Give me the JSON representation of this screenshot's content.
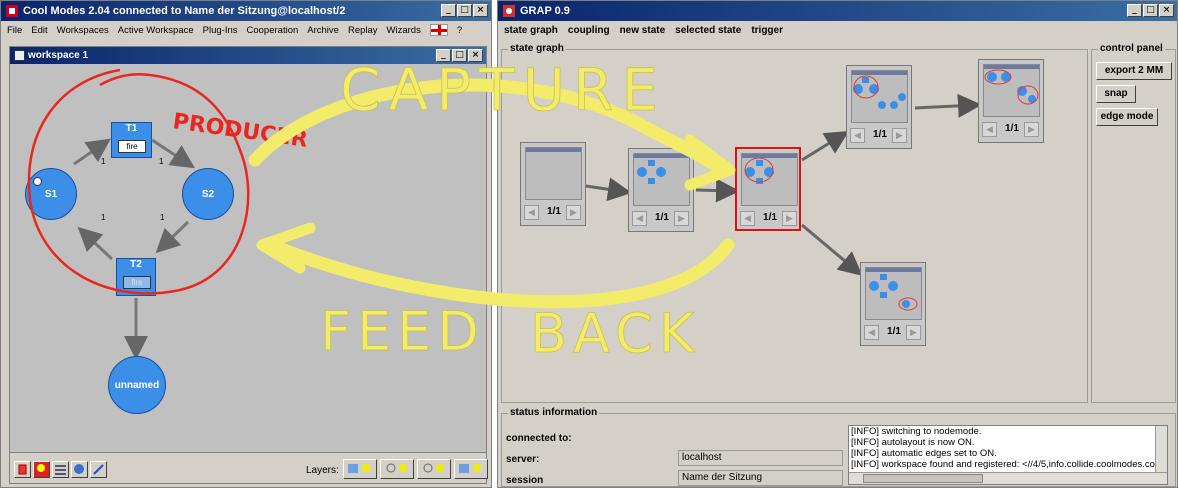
{
  "coolmodes": {
    "title": "Cool Modes 2.04 connected to Name der Sitzung@localhost/2",
    "menu": [
      "File",
      "Edit",
      "Workspaces",
      "Active Workspace",
      "Plug-Ins",
      "Cooperation",
      "Archive",
      "Replay",
      "Wizards",
      "?"
    ],
    "workspace_title": "workspace 1",
    "places": {
      "s1": "S1",
      "s2": "S2",
      "unnamed": "unnamed"
    },
    "transitions": {
      "t1": "T1",
      "t2": "T2",
      "fire": "fire"
    },
    "arc_weight": "1",
    "layers_label": "Layers:"
  },
  "grap": {
    "title": "GRAP 0.9",
    "menu": [
      "state graph",
      "coupling",
      "new state",
      "selected state",
      "trigger"
    ],
    "state_graph_label": "state graph",
    "control_panel_label": "control panel",
    "buttons": {
      "export": "export 2 MM",
      "snap": "snap",
      "edge_mode": "edge mode"
    },
    "node_counter": "1/1",
    "status": {
      "label": "status information",
      "connected_to": "connected to:",
      "server_label": "server:",
      "server_value": "localhost",
      "session_label": "session",
      "session_value": "Name der Sitzung",
      "log": [
        "[INFO] switching to nodemode.",
        "[INFO] autolayout is now ON.",
        "[INFO] automatic edges set to ON.",
        "[INFO] workspace found and registered: <//4/5,info.collide.coolmodes.co"
      ]
    }
  },
  "annotations": {
    "producer": "PRODUCER",
    "capture": "CAPTURE",
    "feed": "FEED",
    "back": "BACK",
    "colors": {
      "ink_yellow": "#f2ec6a",
      "ink_red": "#e8281e",
      "place_blue": "#3b8fe8",
      "selection_red": "#e01010"
    }
  }
}
